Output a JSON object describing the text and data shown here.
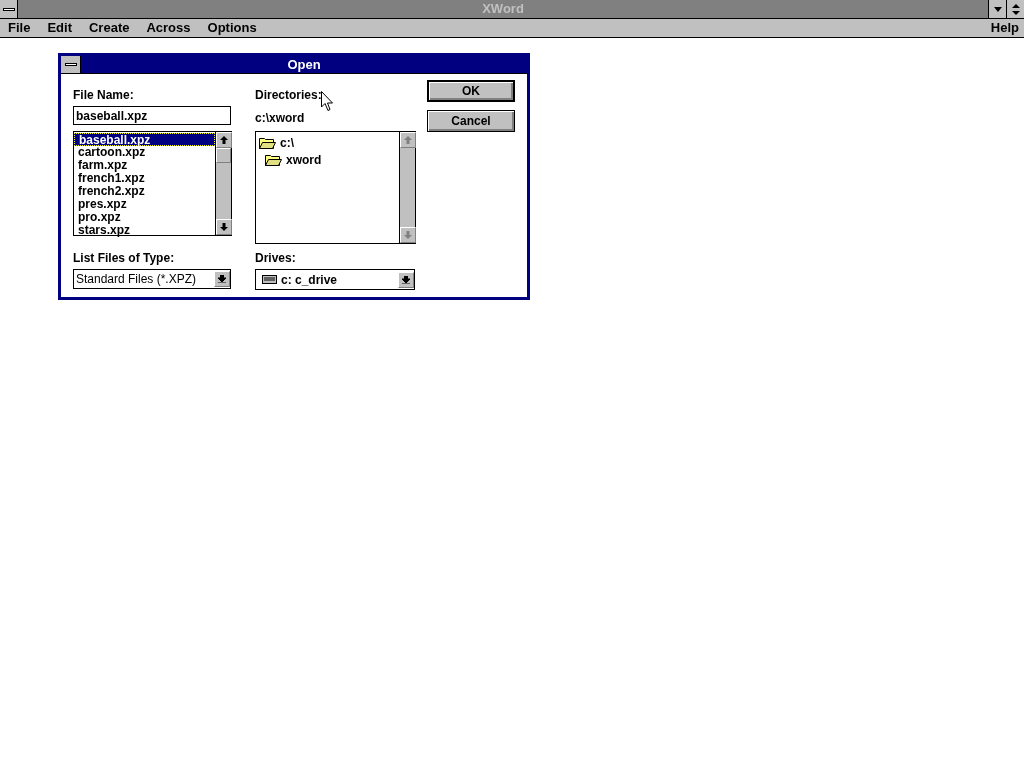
{
  "window": {
    "title": "XWord"
  },
  "menu": [
    {
      "label": "File"
    },
    {
      "label": "Edit"
    },
    {
      "label": "Create"
    },
    {
      "label": "Across"
    },
    {
      "label": "Options"
    }
  ],
  "help_menu": {
    "label": "Help"
  },
  "dialog": {
    "title": "Open",
    "file_name": {
      "label": "File Name:",
      "value": "baseball.xpz"
    },
    "files": [
      {
        "name": "baseball.xpz",
        "selected": true
      },
      {
        "name": "cartoon.xpz",
        "selected": false
      },
      {
        "name": "farm.xpz",
        "selected": false
      },
      {
        "name": "french1.xpz",
        "selected": false
      },
      {
        "name": "french2.xpz",
        "selected": false
      },
      {
        "name": "pres.xpz",
        "selected": false
      },
      {
        "name": "pro.xpz",
        "selected": false
      },
      {
        "name": "stars.xpz",
        "selected": false
      }
    ],
    "file_type": {
      "label": "List Files of Type:",
      "value": "Standard Files (*.XPZ)"
    },
    "directories": {
      "label": "Directories:",
      "path": "c:\\xword",
      "items": [
        {
          "name": "c:\\",
          "open": true,
          "children": [
            {
              "name": "xword",
              "open": true
            }
          ]
        }
      ]
    },
    "drives": {
      "label": "Drives:",
      "value": "c: c_drive"
    },
    "buttons": [
      {
        "label": "OK",
        "default": true
      },
      {
        "label": "Cancel",
        "default": false
      }
    ]
  }
}
